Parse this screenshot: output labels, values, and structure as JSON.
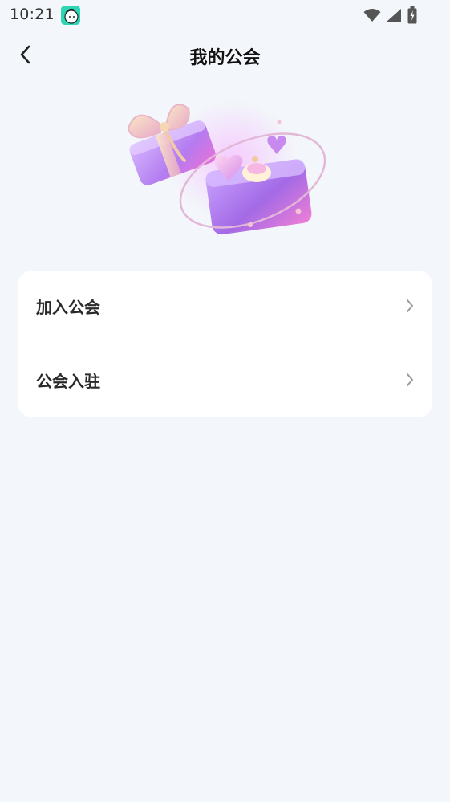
{
  "status_bar": {
    "time": "10:21"
  },
  "nav": {
    "title": "我的公会"
  },
  "menu": {
    "items": [
      {
        "label": "加入公会"
      },
      {
        "label": "公会入驻"
      }
    ]
  },
  "colors": {
    "background": "#f3f6fa",
    "card": "#ffffff",
    "accent": "#c08af0"
  },
  "icons": {
    "back": "chevron-left-icon",
    "row_arrow": "chevron-right-icon",
    "hero": "gift-box-illustration"
  }
}
